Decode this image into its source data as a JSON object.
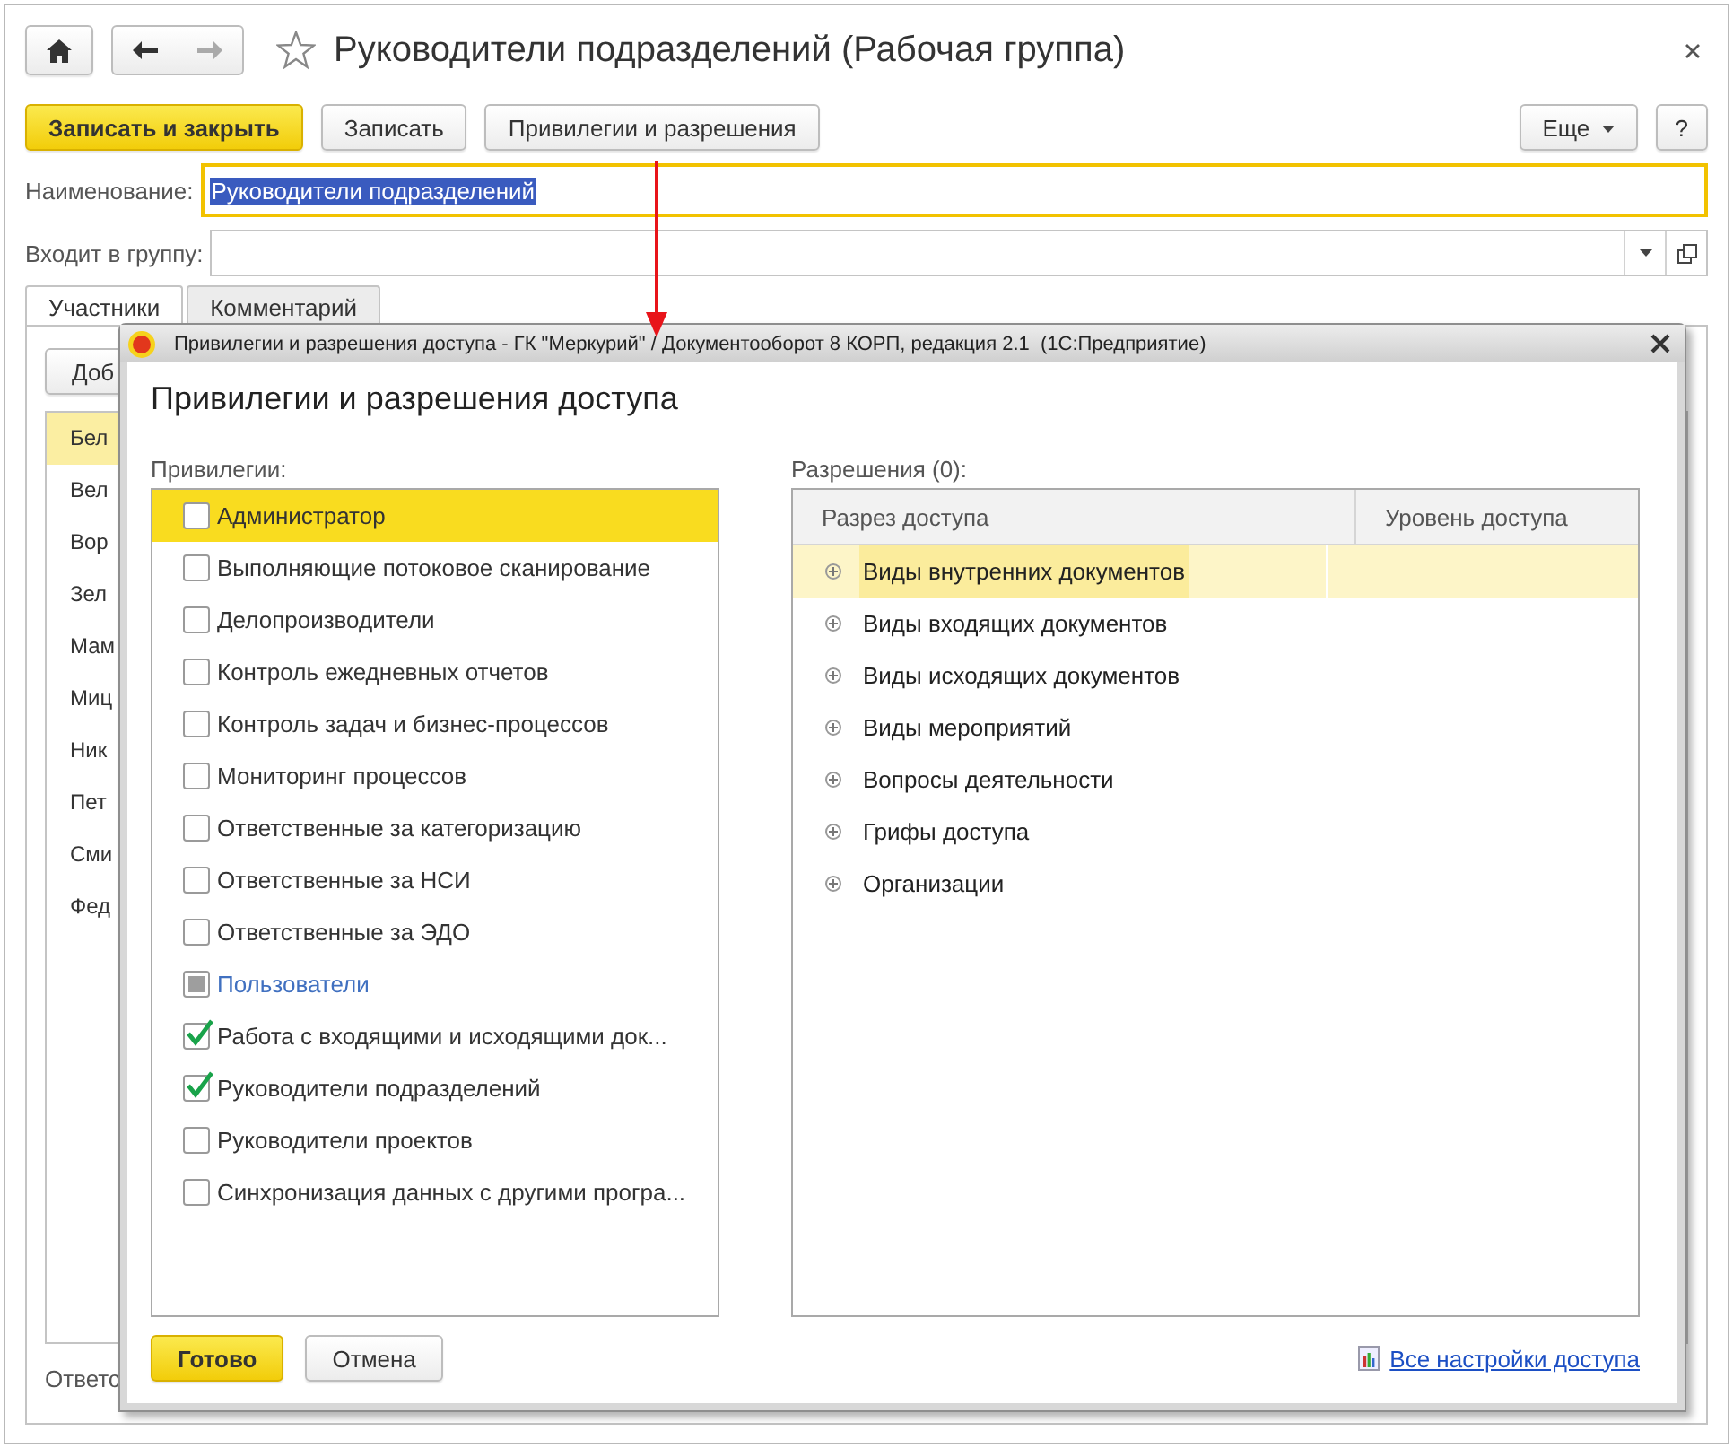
{
  "window": {
    "title": "Руководители подразделений (Рабочая группа)"
  },
  "toolbar": {
    "buttons": [
      {
        "label": "Записать и закрыть",
        "kind": "primary"
      },
      {
        "label": "Записать",
        "kind": "normal"
      },
      {
        "label": "Привилегии и разрешения",
        "kind": "normal"
      }
    ],
    "more": "Еще",
    "help": "?"
  },
  "fields": [
    {
      "label": "Наименование:",
      "value": "Руководители подразделений",
      "focused": true,
      "kind": "text"
    },
    {
      "label": "Входит в группу:",
      "focused": false,
      "kind": "select"
    }
  ],
  "tabs": [
    {
      "label": "Участники",
      "selected": true
    },
    {
      "label": "Комментарий",
      "selected": false
    }
  ],
  "members": {
    "add_button": "Доб",
    "rows": [
      {
        "name": "Бел",
        "selected": true
      },
      {
        "name": "Вел",
        "selected": false
      },
      {
        "name": "Вор",
        "selected": false
      },
      {
        "name": "Зел",
        "selected": false
      },
      {
        "name": "Мам",
        "selected": false
      },
      {
        "name": "Миц",
        "selected": false
      },
      {
        "name": "Ник",
        "selected": false
      },
      {
        "name": "Пет",
        "selected": false
      },
      {
        "name": "Сми",
        "selected": false
      },
      {
        "name": "Фед",
        "selected": false
      }
    ]
  },
  "footer_label": "Ответс",
  "dialog": {
    "title": "Привилегии и разрешения доступа - ГК \"Меркурий\" / Документооборот 8 КОРП, редакция 2.1  (1С:Предприятие)",
    "heading": "Привилегии и разрешения доступа",
    "privileges_label": "Привилегии:",
    "privileges": [
      {
        "label": "Администратор",
        "checked": false,
        "partial": false,
        "selected": true
      },
      {
        "label": "Выполняющие потоковое сканирование",
        "checked": false,
        "partial": false,
        "selected": false
      },
      {
        "label": "Делопроизводители",
        "checked": false,
        "partial": false,
        "selected": false
      },
      {
        "label": "Контроль ежедневных отчетов",
        "checked": false,
        "partial": false,
        "selected": false
      },
      {
        "label": "Контроль задач и бизнес-процессов",
        "checked": false,
        "partial": false,
        "selected": false
      },
      {
        "label": "Мониторинг процессов",
        "checked": false,
        "partial": false,
        "selected": false
      },
      {
        "label": "Ответственные за категоризацию",
        "checked": false,
        "partial": false,
        "selected": false
      },
      {
        "label": "Ответственные за НСИ",
        "checked": false,
        "partial": false,
        "selected": false
      },
      {
        "label": "Ответственные за ЭДО",
        "checked": false,
        "partial": false,
        "selected": false
      },
      {
        "label": "Пользователи",
        "checked": false,
        "partial": true,
        "selected": false
      },
      {
        "label": "Работа с входящими и исходящими док...",
        "checked": true,
        "partial": false,
        "selected": false
      },
      {
        "label": "Руководители подразделений",
        "checked": true,
        "partial": false,
        "selected": false
      },
      {
        "label": "Руководители проектов",
        "checked": false,
        "partial": false,
        "selected": false
      },
      {
        "label": "Синхронизация данных с другими програ...",
        "checked": false,
        "partial": false,
        "selected": false
      }
    ],
    "permissions_label": "Разрешения (0):",
    "columns": [
      "Разрез доступа",
      "Уровень доступа"
    ],
    "permissions": [
      {
        "label": "Виды внутренних документов",
        "expanded": false,
        "selected": true
      },
      {
        "label": "Виды входящих документов",
        "expanded": false,
        "selected": false
      },
      {
        "label": "Виды исходящих документов",
        "expanded": false,
        "selected": false
      },
      {
        "label": "Виды мероприятий",
        "expanded": false,
        "selected": false
      },
      {
        "label": "Вопросы деятельности",
        "expanded": false,
        "selected": false
      },
      {
        "label": "Грифы доступа",
        "expanded": false,
        "selected": false
      },
      {
        "label": "Организации",
        "expanded": false,
        "selected": false
      }
    ],
    "buttons": [
      {
        "label": "Готово",
        "kind": "primary"
      },
      {
        "label": "Отмена",
        "kind": "normal"
      }
    ],
    "link": "Все настройки доступа"
  }
}
